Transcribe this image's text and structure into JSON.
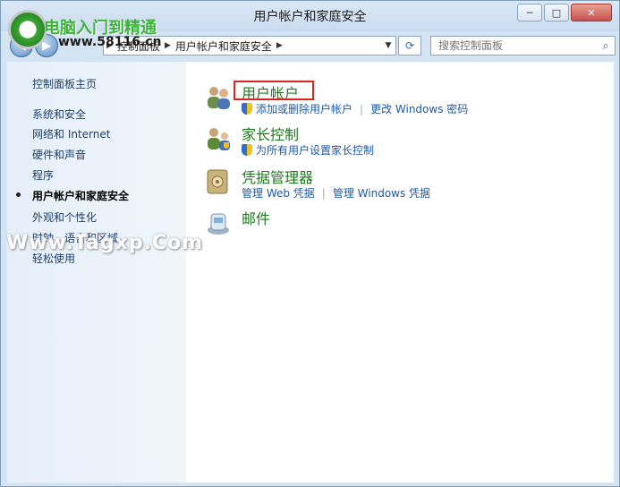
{
  "window": {
    "title": "用户帐户和家庭安全",
    "controls": {
      "minimize": "─",
      "maximize": "□",
      "close": "✕"
    }
  },
  "navbar": {
    "back_icon": "left-arrow",
    "forward_icon": "right-arrow",
    "breadcrumb": [
      "控制面板",
      "用户帐户和家庭安全"
    ],
    "search_placeholder": "搜索控制面板"
  },
  "sidebar": {
    "items": [
      {
        "label": "控制面板主页",
        "current": false
      },
      {
        "label": "系统和安全",
        "current": false
      },
      {
        "label": "网络和 Internet",
        "current": false
      },
      {
        "label": "硬件和声音",
        "current": false
      },
      {
        "label": "程序",
        "current": false
      },
      {
        "label": "用户帐户和家庭安全",
        "current": true
      },
      {
        "label": "外观和个性化",
        "current": false
      },
      {
        "label": "时钟、语言和区域",
        "current": false
      },
      {
        "label": "轻松使用",
        "current": false
      }
    ]
  },
  "main": {
    "categories": [
      {
        "heading": "用户帐户",
        "icon": "users-icon",
        "links": [
          "添加或删除用户帐户",
          "更改 Windows 密码"
        ],
        "shield_first": true
      },
      {
        "heading": "家长控制",
        "icon": "parental-control-icon",
        "links": [
          "为所有用户设置家长控制"
        ],
        "shield_first": true
      },
      {
        "heading": "凭据管理器",
        "icon": "credential-vault-icon",
        "links": [
          "管理 Web 凭据",
          "管理 Windows 凭据"
        ],
        "shield_first": false
      },
      {
        "heading": "邮件",
        "icon": "mail-icon",
        "links": [],
        "shield_first": false
      }
    ]
  },
  "overlays": {
    "logo_text": "电脑入门到精通",
    "logo_url": "www.58116.cn",
    "watermark": "Www.Tagxp.Com"
  },
  "colors": {
    "accent_link": "#1e5aa8",
    "heading_green": "#1c7a1c",
    "highlight_red": "#dd2222"
  }
}
